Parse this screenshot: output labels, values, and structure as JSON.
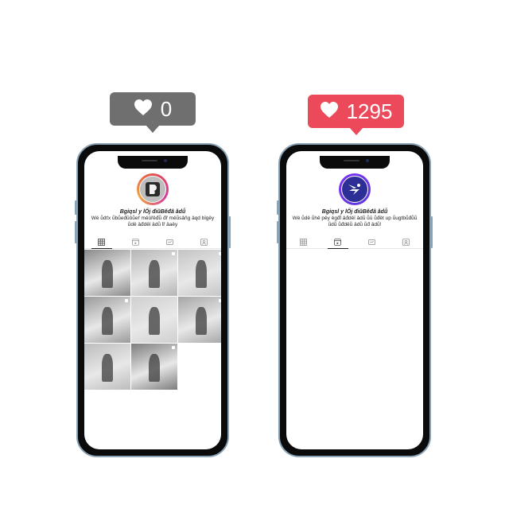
{
  "badges": {
    "left": {
      "count": "0",
      "icon": "heart-icon",
      "color": "#6f6f6f"
    },
    "right": {
      "count": "1295",
      "icon": "heart-icon",
      "color": "#ec4a5a"
    }
  },
  "profiles": {
    "left": {
      "name": "Bgiqsl y lŐj điŭBěđâ ǎdǚ",
      "bio": "Wé ǚdťx ǚbǚeđŭôǚeř měǔřěđǚ đř měǚsảňg ǎqd bǐgěy ǚdě ǎđděǐ ǎdǚ ỉř ǎaěy",
      "tabs": [
        "grid-icon",
        "reels-icon",
        "tagged-icon",
        "user-icon"
      ],
      "active_tab": 0,
      "posts": [
        {
          "name": "post-woman-reading-book",
          "tone": "#8a8a8a"
        },
        {
          "name": "post-man-at-desk",
          "tone": "#b5b5b5"
        },
        {
          "name": "post-woman-sitting-floor",
          "tone": "#c4c4c4"
        },
        {
          "name": "post-vintage-car",
          "tone": "#9a9a9a"
        },
        {
          "name": "post-woman-in-skirt",
          "tone": "#cfcfcf"
        },
        {
          "name": "post-laptop-on-bed",
          "tone": "#a6a6a6"
        },
        {
          "name": "post-ferris-wheel",
          "tone": "#bcbcbc"
        },
        {
          "name": "post-man-crouching-street",
          "tone": "#7d7d7d"
        }
      ]
    },
    "right": {
      "name": "Bgiqsl y lŐj điŭBěđâ ǎdǚ",
      "bio": "Wé ǚdě ǚhě pěy ěgđỉ ǎđděǐ ǎdǚ ǚŭ ǚđět up ǚugtbǚđǚǚ ǚdǚ ǚđděǚ ǎdǚ ǚđ ǎdǚ!",
      "tabs": [
        "grid-icon",
        "reels-icon",
        "tagged-icon",
        "user-icon"
      ],
      "active_tab": 1,
      "posts": []
    }
  }
}
